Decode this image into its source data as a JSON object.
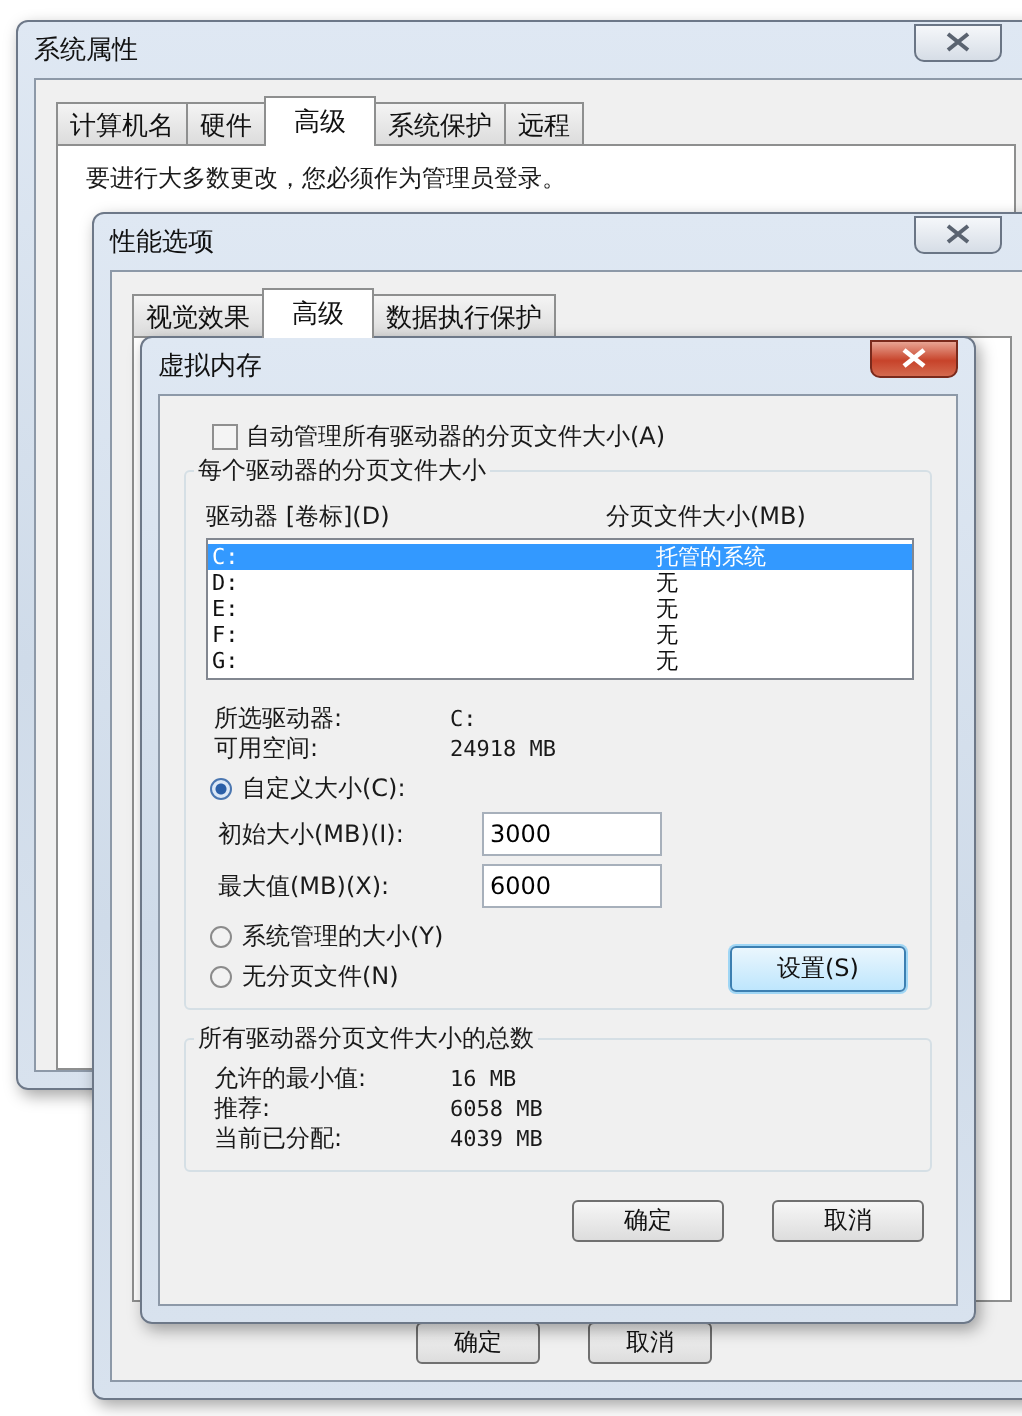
{
  "system_properties": {
    "title": "系统属性",
    "tabs": [
      {
        "label": "计算机名",
        "selected": false
      },
      {
        "label": "硬件",
        "selected": false
      },
      {
        "label": "高级",
        "selected": true
      },
      {
        "label": "系统保护",
        "selected": false
      },
      {
        "label": "远程",
        "selected": false
      }
    ],
    "notice": "要进行大多数更改，您必须作为管理员登录。"
  },
  "performance_options": {
    "title": "性能选项",
    "tabs": [
      {
        "label": "视觉效果",
        "selected": false
      },
      {
        "label": "高级",
        "selected": true
      },
      {
        "label": "数据执行保护",
        "selected": false
      }
    ],
    "buttons": [
      "确定",
      "取消"
    ]
  },
  "virtual_memory": {
    "title": "虚拟内存",
    "auto_manage": {
      "label": "自动管理所有驱动器的分页文件大小(A)",
      "checked": false
    },
    "group_title": "每个驱动器的分页文件大小",
    "columns": [
      "驱动器 [卷标](D)",
      "分页文件大小(MB)"
    ],
    "drives": [
      {
        "drive": "C:",
        "size": "托管的系统",
        "selected": true
      },
      {
        "drive": "D:",
        "size": "无",
        "selected": false
      },
      {
        "drive": "E:",
        "size": "无",
        "selected": false
      },
      {
        "drive": "F:",
        "size": "无",
        "selected": false
      },
      {
        "drive": "G:",
        "size": "无",
        "selected": false
      }
    ],
    "info": [
      {
        "label": "所选驱动器:",
        "value": "C:"
      },
      {
        "label": "可用空间:",
        "value": "24918 MB"
      }
    ],
    "size_options": [
      {
        "kind": "custom",
        "label": "自定义大小(C):",
        "selected": true
      },
      {
        "kind": "system",
        "label": "系统管理的大小(Y)",
        "selected": false
      },
      {
        "kind": "none",
        "label": "无分页文件(N)",
        "selected": false
      }
    ],
    "fields": [
      {
        "label": "初始大小(MB)(I):",
        "value": "3000"
      },
      {
        "label": "最大值(MB)(X):",
        "value": "6000"
      }
    ],
    "set_button": "设置(S)",
    "totals": {
      "title": "所有驱动器分页文件大小的总数",
      "rows": [
        {
          "label": "允许的最小值:",
          "value": "16 MB"
        },
        {
          "label": "推荐:",
          "value": "6058 MB"
        },
        {
          "label": "当前已分配:",
          "value": "4039 MB"
        }
      ]
    },
    "buttons": [
      "确定",
      "取消"
    ]
  }
}
